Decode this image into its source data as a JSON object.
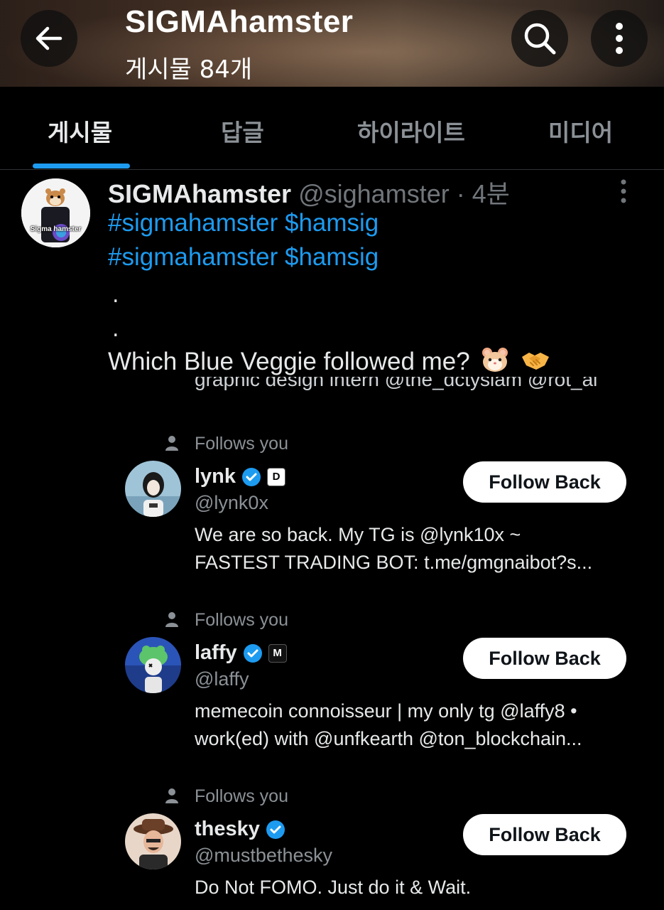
{
  "header": {
    "title": "SIGMAhamster",
    "post_count": "게시물 84개",
    "back_icon": "arrow-left-icon",
    "search_icon": "search-icon",
    "more_icon": "more-vertical-icon"
  },
  "tabs": [
    {
      "label": "게시물",
      "active": true
    },
    {
      "label": "답글",
      "active": false
    },
    {
      "label": "하이라이트",
      "active": false
    },
    {
      "label": "미디어",
      "active": false
    }
  ],
  "post": {
    "author_name": "SIGMAhamster",
    "author_handle": "@sighamster",
    "time": "· 4분",
    "avatar_caption": "Sigma hamster",
    "hashtag_line_1": "#sigmahamster $hamsig",
    "hashtag_line_2": "#sigmahamster $hamsig",
    "dot_1": ".",
    "dot_2": ".",
    "question": "Which Blue Veggie followed me?",
    "emojis": [
      "hamster-face-icon",
      "handshake-icon"
    ]
  },
  "embedded": {
    "cutoff_text": "graphic design intern @the_dctysiam @rot_ai",
    "users": [
      {
        "follows_label": "Follows you",
        "name": "lynk",
        "handle": "@lynk0x",
        "badge": "D",
        "bio_1": "We are so back. My TG is @lynk10x ~",
        "bio_2": "FASTEST TRADING BOT: t.me/gmgnaibot?s...",
        "button": "Follow Back"
      },
      {
        "follows_label": "Follows you",
        "name": "laffy",
        "handle": "@laffy",
        "badge": "M",
        "bio_1": "memecoin connoisseur | my only tg @laffy8 •",
        "bio_2": "work(ed) with @unfkearth @ton_blockchain...",
        "button": "Follow Back"
      },
      {
        "follows_label": "Follows you",
        "name": "thesky",
        "handle": "@mustbethesky",
        "badge": "",
        "bio_1": "Do Not FOMO. Just do it & Wait.",
        "bio_2": "",
        "button": "Follow Back"
      }
    ]
  },
  "colors": {
    "accent": "#1d9bf0",
    "background": "#000000",
    "muted": "#71767b",
    "verified": "#1d9bf0"
  }
}
